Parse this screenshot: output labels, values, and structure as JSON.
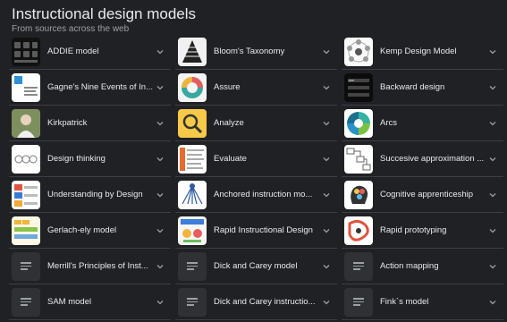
{
  "header": {
    "title": "Instructional design models",
    "subtitle": "From sources across the web"
  },
  "items": [
    {
      "label": "ADDIE model",
      "thumb": "image"
    },
    {
      "label": "Bloom's Taxonomy",
      "thumb": "image"
    },
    {
      "label": "Kemp Design Model",
      "thumb": "image"
    },
    {
      "label": "Gagne's Nine Events of In...",
      "thumb": "image"
    },
    {
      "label": "Assure",
      "thumb": "image"
    },
    {
      "label": "Backward design",
      "thumb": "image"
    },
    {
      "label": "Kirkpatrick",
      "thumb": "image"
    },
    {
      "label": "Analyze",
      "thumb": "image"
    },
    {
      "label": "Arcs",
      "thumb": "image"
    },
    {
      "label": "Design thinking",
      "thumb": "image"
    },
    {
      "label": "Evaluate",
      "thumb": "image"
    },
    {
      "label": "Succesive approximation ...",
      "thumb": "image"
    },
    {
      "label": "Understanding by Design",
      "thumb": "image"
    },
    {
      "label": "Anchored instruction mo...",
      "thumb": "image"
    },
    {
      "label": "Cognitive apprenticeship",
      "thumb": "image"
    },
    {
      "label": "Gerlach-ely model",
      "thumb": "image"
    },
    {
      "label": "Rapid Instructional Design",
      "thumb": "image"
    },
    {
      "label": "Rapid prototyping",
      "thumb": "image"
    },
    {
      "label": "Merrill's Principles of Inst...",
      "thumb": "placeholder"
    },
    {
      "label": "Dick and Carey model",
      "thumb": "placeholder"
    },
    {
      "label": "Action mapping",
      "thumb": "placeholder"
    },
    {
      "label": "SAM model",
      "thumb": "placeholder"
    },
    {
      "label": "Dick and Carey instructio...",
      "thumb": "placeholder"
    },
    {
      "label": "Fink`s model",
      "thumb": "placeholder"
    }
  ],
  "icons": {
    "expand": "chevron-down-icon",
    "placeholder": "document-lines-icon"
  },
  "colors": {
    "background": "#202124",
    "divider": "#3c4043",
    "text": "#e8eaed",
    "muted": "#9aa0a6",
    "placeholder_bg": "#303134"
  }
}
